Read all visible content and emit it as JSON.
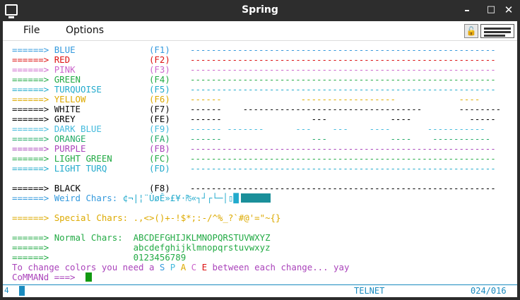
{
  "window": {
    "title": "Spring",
    "minimize": "–",
    "maximize": "□",
    "close": "✕"
  },
  "menu": {
    "file": "File",
    "options": "Options"
  },
  "toolbar": {
    "lock_icon": "lock-icon",
    "keyboard_icon": "keyboard-icon"
  },
  "colors": {
    "blue": "#3399dd",
    "red": "#dd1111",
    "pink": "#cc66cc",
    "green": "#22aa44",
    "turquoise": "#22aacc",
    "yellow": "#ddaa00",
    "white": "#111111",
    "grey": "#000000",
    "dark_blue": "#44bbdd",
    "orange": "#22aa66",
    "purple": "#aa44bb",
    "light_green": "#22aa44",
    "light_turq": "#22aacc",
    "black": "#000000"
  },
  "terminal": {
    "arrow": "======>",
    "color_rows": [
      {
        "name": "BLUE",
        "key": "(F1)",
        "dashes": "----------------------------------------------------------"
      },
      {
        "name": "RED",
        "key": "(F2)",
        "dashes": "----------------------------------------------------------"
      },
      {
        "name": "PINK",
        "key": "(F3)",
        "dashes": "----------------------------------------------------------"
      },
      {
        "name": "GREEN",
        "key": "(F4)",
        "dashes": "----------------------------------------------------------"
      },
      {
        "name": "TURQUOISE",
        "key": "(F5)",
        "dashes": "----------------------------------------------------------"
      },
      {
        "name": "YELLOW",
        "key": "(F6)",
        "dashes": "------               ------------------            ----"
      },
      {
        "name": "WHITE",
        "key": "(F7)",
        "dashes": "------    ----------------------------------       --------"
      },
      {
        "name": "GREY",
        "key": "(FE)",
        "dashes": "------                 ---            ----           -----"
      },
      {
        "name": "DARK BLUE",
        "key": "(F9)",
        "dashes": "------ -------      ---    ---    ----       -----------"
      },
      {
        "name": "ORANGE",
        "key": "(FA)",
        "dashes": "------                 ---            ----    -----------"
      },
      {
        "name": "PURPLE",
        "key": "(FB)",
        "dashes": "----------------------------------------------------------"
      },
      {
        "name": "LIGHT GREEN",
        "key": "(FC)",
        "dashes": "----------------------------------------------------------"
      },
      {
        "name": "LIGHT TURQ",
        "key": "(FD)",
        "dashes": "----------------------------------------------------------"
      }
    ],
    "black_row": {
      "name": "BLACK",
      "key": "(F8)",
      "dashes": "----------------------------------------------------------"
    },
    "weird_label": "Weird Chars:",
    "weird_chars": "¢¬|¦¨ÙøÊ»£¥·₧«┐┘┌└─│▯█",
    "special_label": "Special Chars:",
    "special_chars": ".,<>()+-!$*;:-/^%_?`#@'=\"~{}",
    "normal_label": "Normal Chars:",
    "upper": "ABCDEFGHIJKLMNOPQRSTUVWXYZ",
    "lower": "abcdefghijklmnopqrstuvwxyz",
    "digits": "0123456789",
    "hint_prefix": "To change colors you need a",
    "space_letters": [
      "S",
      "P",
      "A",
      "C",
      "E"
    ],
    "hint_suffix": "between each change... yay",
    "command_prompt": "CoMMANd ===>"
  },
  "status": {
    "indicator": "4",
    "connection": "TELNET",
    "cursor_pos": "024/016"
  }
}
